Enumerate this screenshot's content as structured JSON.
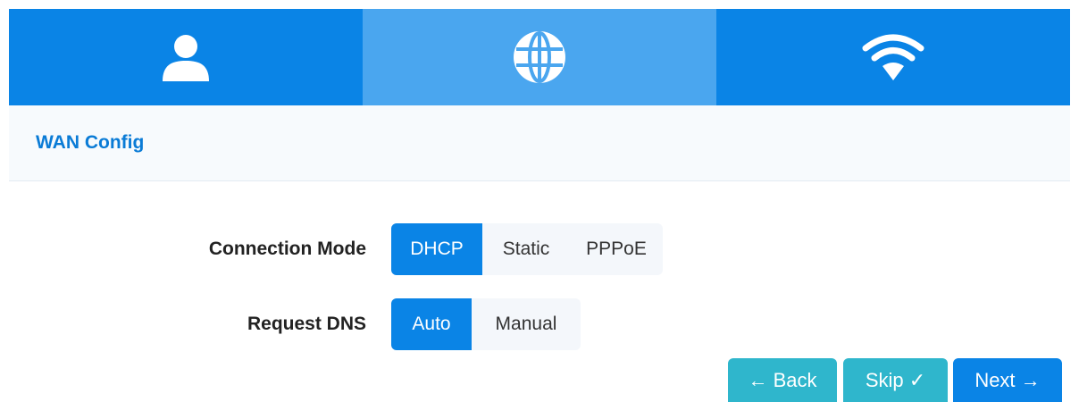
{
  "steps": [
    {
      "icon": "user-icon",
      "active": false
    },
    {
      "icon": "globe-icon",
      "active": true
    },
    {
      "icon": "wifi-icon",
      "active": false
    }
  ],
  "section": {
    "title": "WAN Config"
  },
  "form": {
    "connection_mode": {
      "label": "Connection Mode",
      "options": [
        "DHCP",
        "Static",
        "PPPoE"
      ],
      "selected": "DHCP"
    },
    "request_dns": {
      "label": "Request DNS",
      "options": [
        "Auto",
        "Manual"
      ],
      "selected": "Auto"
    }
  },
  "buttons": {
    "back": "← Back",
    "skip": "Skip ✓",
    "next": "Next →"
  },
  "colors": {
    "primary": "#0a84e6",
    "active_tab": "#4aa6ef",
    "secondary_button": "#2fb6cc",
    "title": "#0a7bd6"
  }
}
